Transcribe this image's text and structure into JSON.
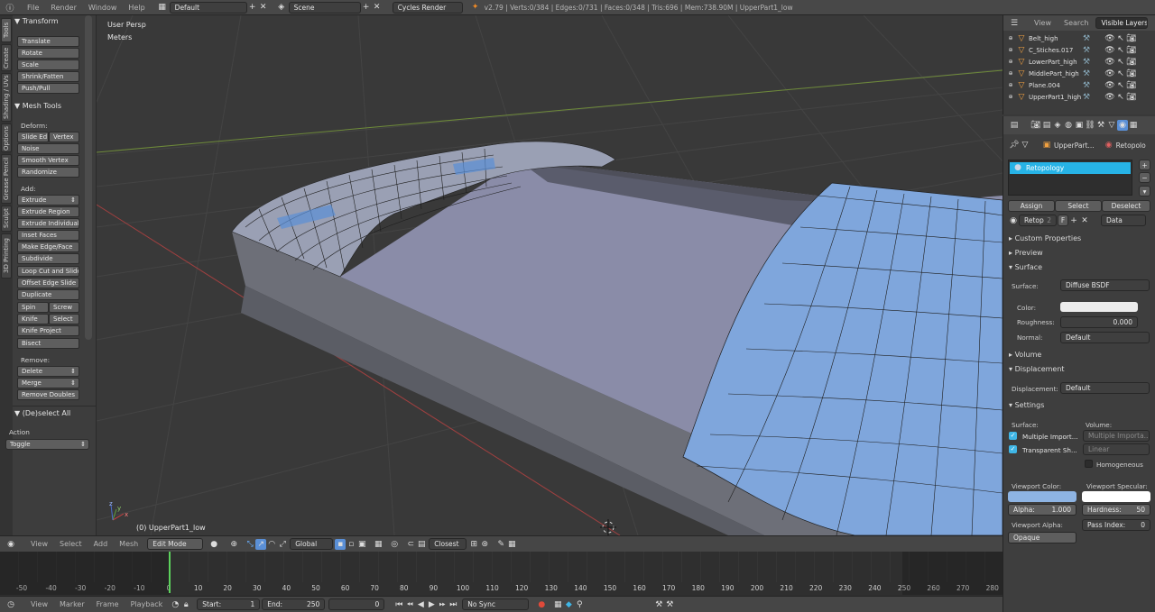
{
  "top": {
    "menus": [
      "File",
      "Render",
      "Window",
      "Help"
    ],
    "screen_layout": "Default",
    "scene": "Scene",
    "render_engine": "Cycles Render",
    "stats": "v2.79 | Verts:0/384 | Edges:0/731 | Faces:0/348 | Tris:696 | Mem:738.90M | UpperPart1_low"
  },
  "vtabs": [
    "Tools",
    "Create",
    "Shading / UVs",
    "Options",
    "Grease Pencil",
    "Sculpt",
    "3D Printing"
  ],
  "toolshelf": {
    "transform_header": "Transform",
    "transform": [
      "Translate",
      "Rotate",
      "Scale",
      "Shrink/Fatten",
      "Push/Pull"
    ],
    "mesh_header": "Mesh Tools",
    "deform_label": "Deform:",
    "slide_edge": "Slide Ed",
    "vertex": "Vertex",
    "deform": [
      "Noise",
      "Smooth Vertex",
      "Randomize"
    ],
    "add_label": "Add:",
    "extrude": "Extrude",
    "add": [
      "Extrude Region",
      "Extrude Individual",
      "Inset Faces",
      "Make Edge/Face",
      "Subdivide",
      "Loop Cut and Slide",
      "Offset Edge Slide",
      "Duplicate"
    ],
    "spin": "Spin",
    "screw": "Screw",
    "knife": "Knife",
    "select": "Select",
    "knife_project": "Knife Project",
    "bisect": "Bisect",
    "remove_label": "Remove:",
    "delete": "Delete",
    "merge": "Merge",
    "remove_doubles": "Remove Doubles",
    "deselect_header": "(De)select All",
    "action_label": "Action",
    "action_value": "Toggle"
  },
  "viewport": {
    "view_name": "User Persp",
    "units": "Meters",
    "object_label": "(0) UpperPart1_low"
  },
  "vheader": {
    "menus": [
      "View",
      "Select",
      "Add",
      "Mesh"
    ],
    "mode": "Edit Mode",
    "orientation": "Global",
    "snap": "Closest"
  },
  "timeline": {
    "ticks": [
      "-50",
      "-40",
      "-30",
      "-20",
      "-10",
      "0",
      "10",
      "20",
      "30",
      "40",
      "50",
      "60",
      "70",
      "80",
      "90",
      "100",
      "110",
      "120",
      "130",
      "140",
      "150",
      "160",
      "170",
      "180",
      "190",
      "200",
      "210",
      "220",
      "230",
      "240",
      "250",
      "260",
      "270",
      "280"
    ],
    "current_frame": 0
  },
  "tlfooter": {
    "menus": [
      "View",
      "Marker",
      "Frame",
      "Playback"
    ],
    "start_label": "Start:",
    "start_value": "1",
    "end_label": "End:",
    "end_value": "250",
    "current": "0",
    "sync": "No Sync"
  },
  "outliner": {
    "tabs": [
      "View",
      "Search",
      "Visible Layers"
    ],
    "items": [
      "Belt_high",
      "C_Stiches.017",
      "LowerPart_high",
      "MiddlePart_high",
      "Plane.004",
      "UpperPart1_high"
    ]
  },
  "props": {
    "breadcrumb_object": "UpperPart...",
    "breadcrumb_material": "Retopolo",
    "material_slot": "Retopology",
    "assign": "Assign",
    "select": "Select",
    "deselect": "Deselect",
    "material_name": "Retop",
    "users": "2",
    "fake_user": "F",
    "link": "Data",
    "sections": {
      "custom_properties": "Custom Properties",
      "preview": "Preview",
      "surface": "Surface",
      "volume": "Volume",
      "displacement": "Displacement",
      "settings": "Settings"
    },
    "surface_label": "Surface:",
    "surface_value": "Diffuse BSDF",
    "color_label": "Color:",
    "roughness_label": "Roughness:",
    "roughness_value": "0.000",
    "normal_label": "Normal:",
    "normal_value": "Default",
    "displacement_label": "Displacement:",
    "displacement_value": "Default",
    "settings_surface": "Surface:",
    "settings_volume": "Volume:",
    "multiple_importance": "Multiple Import...",
    "multiple_importance_vol": "Multiple Importa...",
    "transparent_shadows": "Transparent Sh...",
    "linear": "Linear",
    "homogeneous": "Homogeneous",
    "viewport_color": "Viewport Color:",
    "viewport_specular": "Viewport Specular:",
    "alpha_label": "Alpha:",
    "alpha_value": "1.000",
    "hardness_label": "Hardness:",
    "hardness_value": "50",
    "viewport_alpha": "Viewport Alpha:",
    "pass_index_label": "Pass Index:",
    "pass_index_value": "0",
    "blend_mode": "Opaque"
  },
  "colors": {
    "accent": "#5a8fd6",
    "selected_slot": "#27b3e6",
    "viewport_color": "#8eb4e3",
    "mesh_blue": "#7fa6dc"
  }
}
